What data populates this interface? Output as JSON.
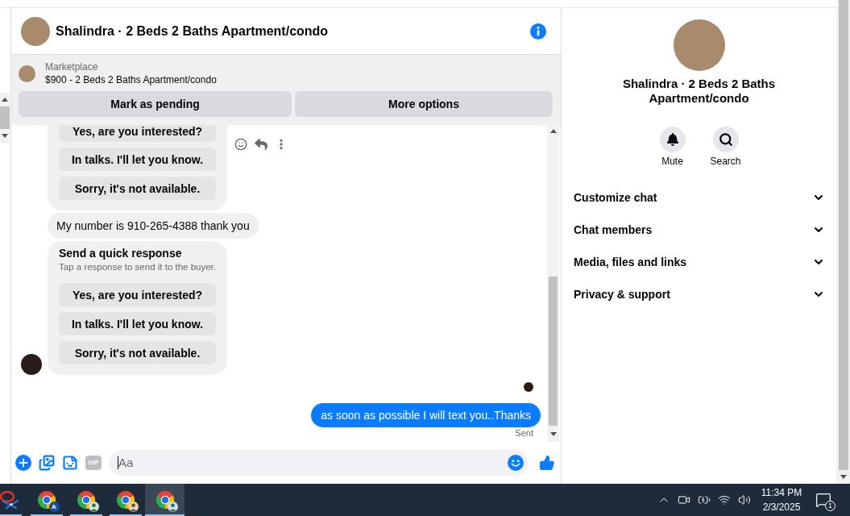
{
  "header": {
    "title": "Shalindra · 2 Beds 2 Baths Apartment/condo"
  },
  "listing": {
    "source": "Marketplace",
    "title": "$900 - 2 Beds 2 Baths Apartment/condo",
    "buttons": [
      "Mark as pending",
      "More options"
    ]
  },
  "conversation": [
    {
      "outgoing": false,
      "read_receipt": false,
      "messages": [
        {
          "kind": "quick_replies",
          "hovered": true,
          "options": [
            "Yes, are you interested?",
            "In talks. I'll let you know.",
            "Sorry, it's not available."
          ]
        },
        {
          "kind": "text",
          "hovered": false,
          "text": "My number is 910-265-4388 thank you"
        },
        {
          "kind": "quick_replies",
          "hovered": false,
          "title": "Send a quick response",
          "subtitle": "Tap a response to send it to the buyer.",
          "options": [
            "Yes, are you interested?",
            "In talks. I'll let you know.",
            "Sorry, it's not available."
          ]
        }
      ]
    },
    {
      "outgoing": true,
      "read_receipt": true,
      "messages": [
        {
          "kind": "text",
          "hovered": false,
          "text": "as soon as possible I will text you..Thanks",
          "status": "Sent"
        }
      ]
    }
  ],
  "composer": {
    "placeholder": "Aa",
    "focused": true,
    "gif_label": "GIF"
  },
  "details": {
    "title": "Shalindra · 2 Beds 2 Baths Apartment/condo",
    "actions": [
      {
        "kind": "mute",
        "label": "Mute"
      },
      {
        "kind": "search",
        "label": "Search"
      }
    ],
    "sections": [
      {
        "label": "Customize chat",
        "expanded": false
      },
      {
        "label": "Chat members",
        "expanded": false
      },
      {
        "label": "Media, files and links",
        "expanded": false
      },
      {
        "label": "Privacy & support",
        "expanded": false
      }
    ]
  },
  "taskbar": {
    "apps": [
      {
        "kind": "snipping_tool",
        "selected": false
      },
      {
        "kind": "chrome",
        "selected": false,
        "badge": "A",
        "color": "#1c4f9c"
      },
      {
        "kind": "chrome",
        "selected": false,
        "color": "#cfe6cf"
      },
      {
        "kind": "chrome",
        "selected": false,
        "color": "#f7cfa0"
      },
      {
        "kind": "chrome",
        "selected": true,
        "color": "#c4e2ea"
      }
    ],
    "time": "11:34 PM",
    "date": "2/3/2025",
    "notifications": "1"
  }
}
